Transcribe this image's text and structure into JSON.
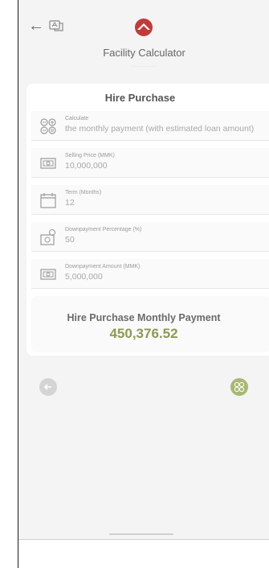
{
  "header": {
    "title": "Facility Calculator",
    "subtitle_dots": "···········"
  },
  "card": {
    "title": "Hire Purchase",
    "fields": [
      {
        "label": "Calculate",
        "value": "the monthly payment (with estimated loan amount)",
        "icon": "calculator-icon"
      },
      {
        "label": "Selling Price (MMK)",
        "value": "10,000,000",
        "icon": "cash-icon"
      },
      {
        "label": "Term (Months)",
        "value": "12",
        "icon": "calendar-icon"
      },
      {
        "label": "Downpayment Percentage (%)",
        "value": "50",
        "icon": "money-percent-icon"
      },
      {
        "label": "Downpayment Amount (MMK)",
        "value": "5,000,000",
        "icon": "cash-icon"
      }
    ],
    "result": {
      "label": "Hire Purchase Monthly Payment",
      "value": "450,376.52"
    }
  },
  "colors": {
    "accent": "#8c9a52",
    "brand": "#c23b3b"
  }
}
